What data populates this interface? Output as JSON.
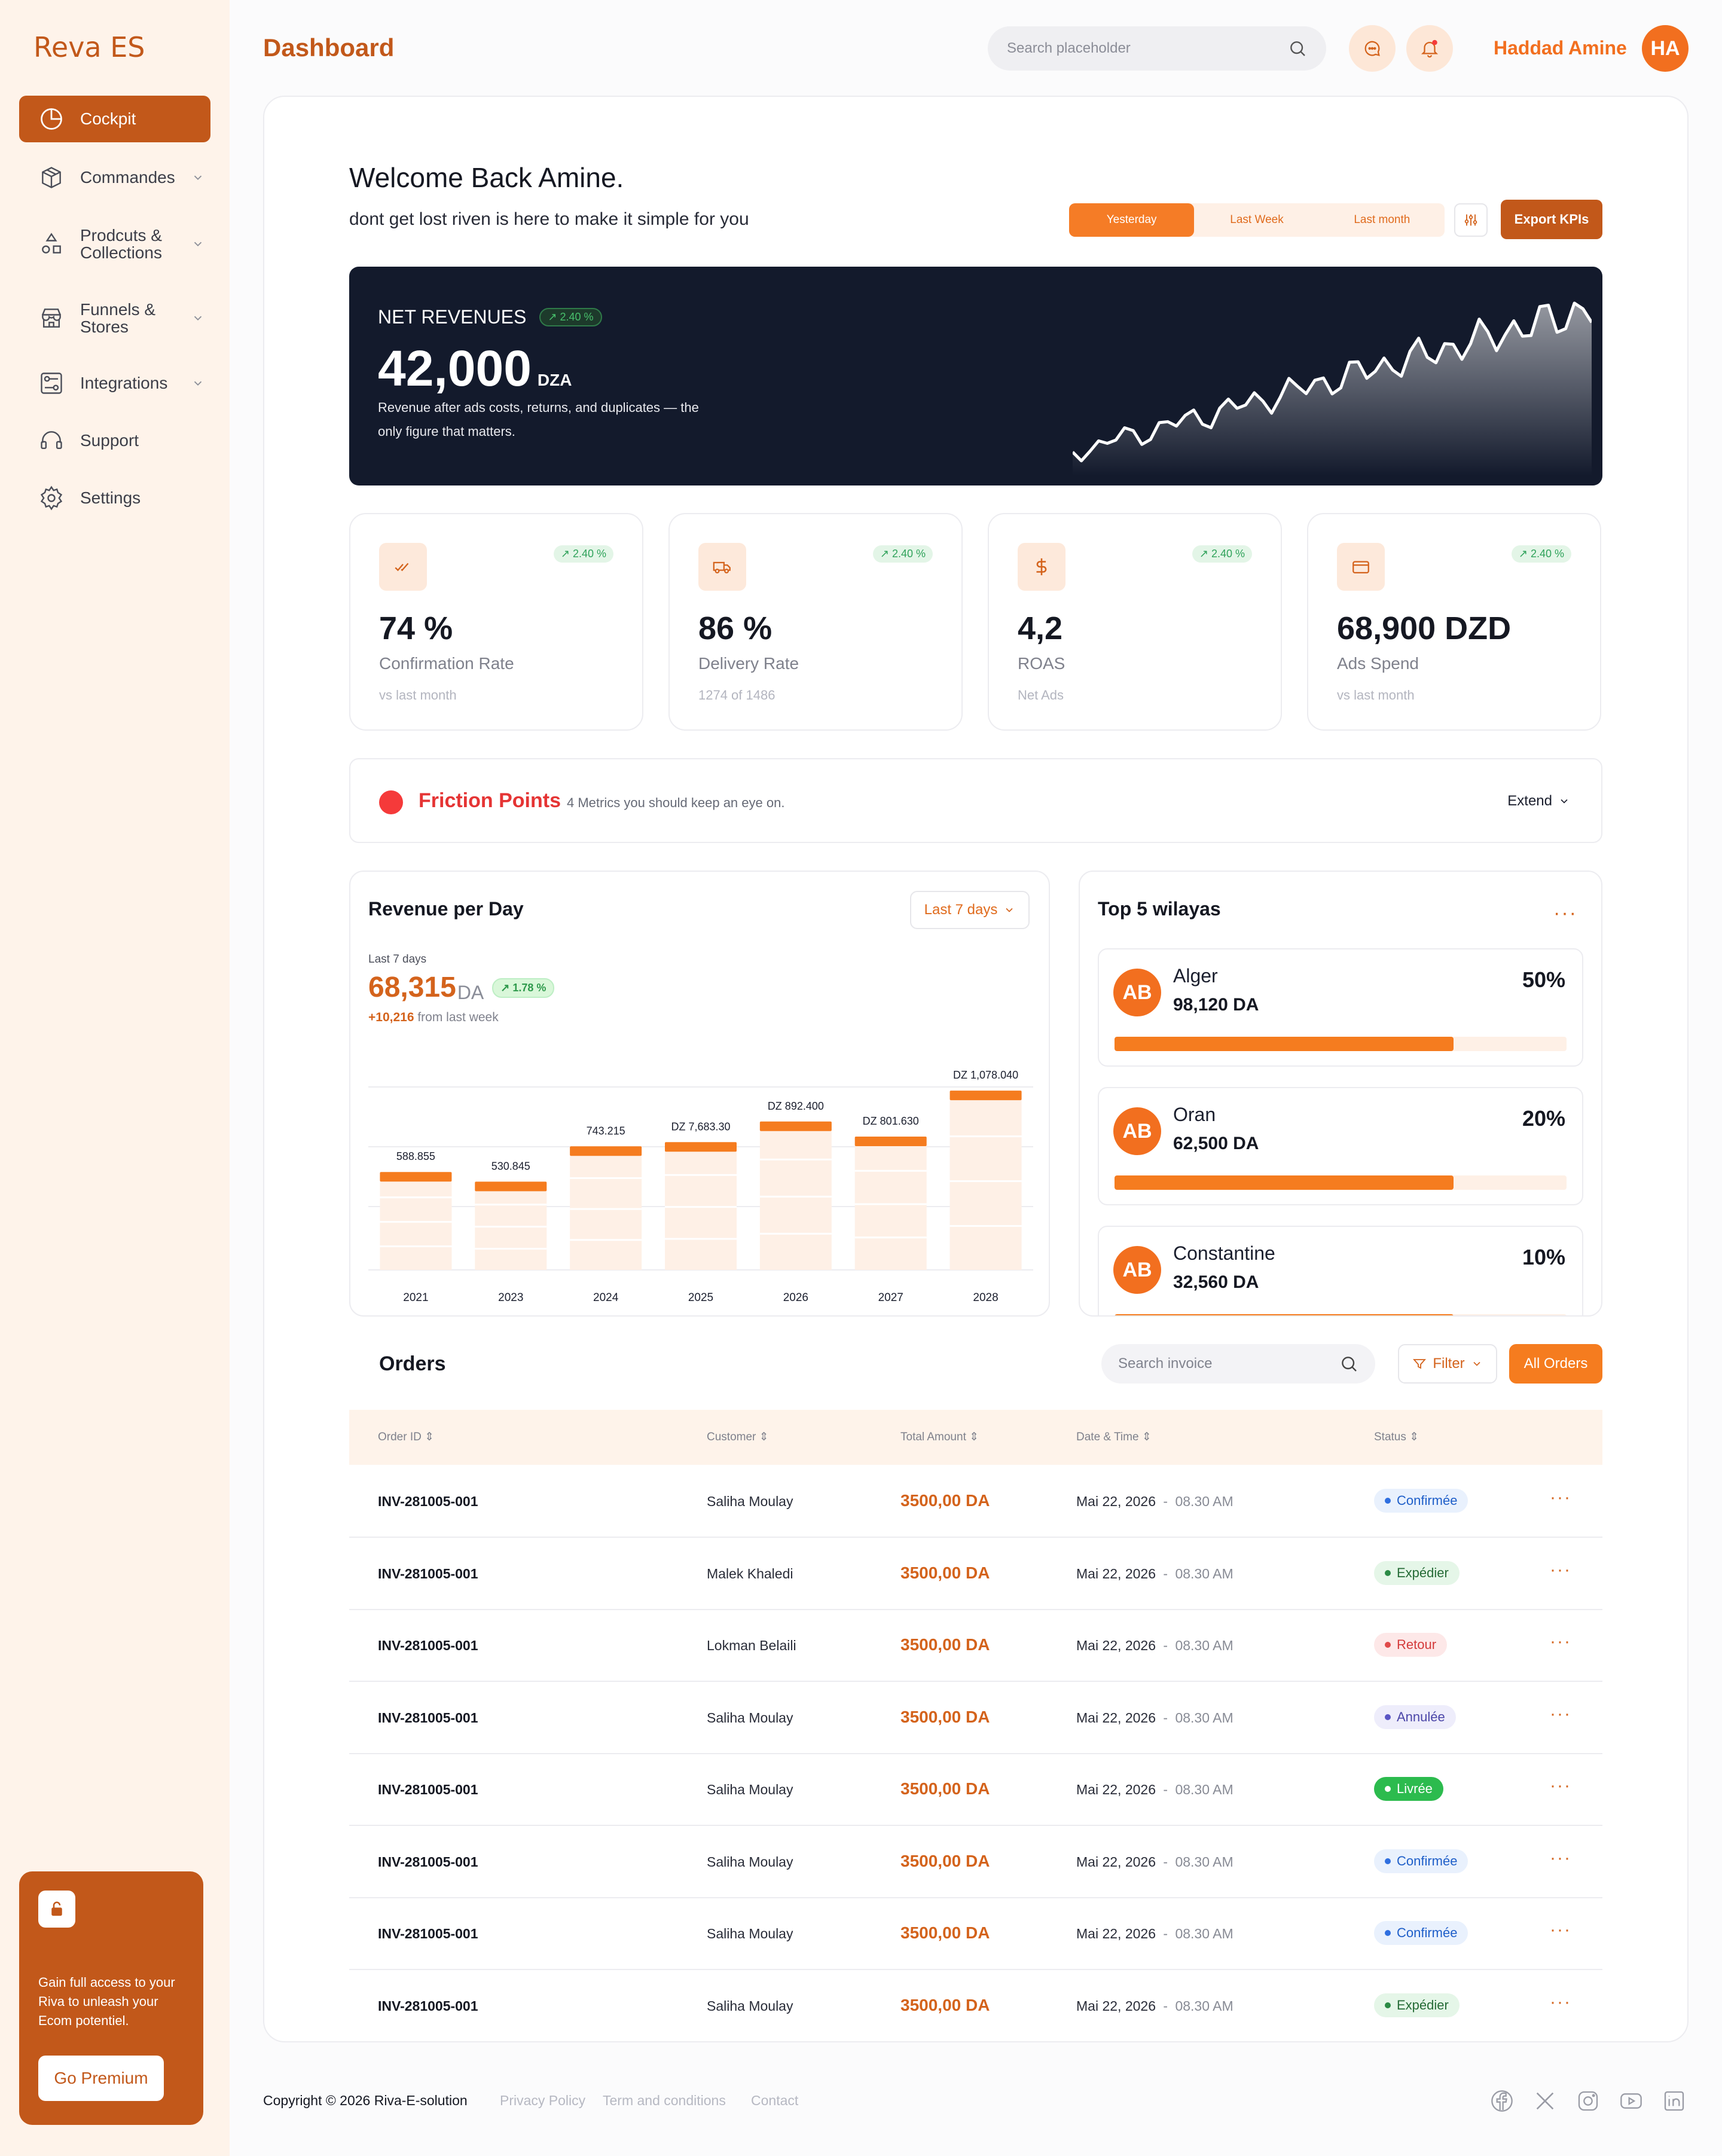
{
  "sidebar": {
    "logo": "Reva ES",
    "items": [
      {
        "label": "Cockpit",
        "icon": "pie-chart-icon",
        "active": true
      },
      {
        "label": "Commandes",
        "icon": "box-icon",
        "chevron": true
      },
      {
        "label": "Prodcuts & Collections",
        "icon": "shapes-icon",
        "chevron": true
      },
      {
        "label": "Funnels & Stores",
        "icon": "store-icon",
        "chevron": true
      },
      {
        "label": "Integrations",
        "icon": "integrations-icon",
        "chevron": true
      },
      {
        "label": "Support",
        "icon": "headset-icon"
      },
      {
        "label": "Settings",
        "icon": "gear-icon"
      }
    ],
    "promo": {
      "text": "Gain full access to your Riva to unleash your Ecom potentiel.",
      "button": "Go Premium"
    }
  },
  "header": {
    "title": "Dashboard",
    "search_placeholder": "Search placeholder",
    "user_name": "Haddad Amine",
    "user_initials": "HA"
  },
  "welcome": {
    "title": "Welcome Back Amine.",
    "subtitle": "dont get lost riven is here to make it simple for you",
    "ranges": [
      "Yesterday",
      "Last Week",
      "Last month"
    ],
    "active_range": "Yesterday",
    "export_label": "Export KPIs"
  },
  "net_revenue": {
    "label": "NET REVENUES",
    "badge": "2.40 %",
    "value": "42,000",
    "unit": "DZA",
    "description": "Revenue after ads costs, returns, and duplicates — the only figure that matters."
  },
  "kpis": [
    {
      "icon": "double-check-icon",
      "badge": "2.40 %",
      "value": "74 %",
      "label": "Confirmation Rate",
      "sub": "vs last month"
    },
    {
      "icon": "truck-icon",
      "badge": "2.40 %",
      "value": "86 %",
      "label": "Delivery Rate",
      "sub": "1274 of 1486"
    },
    {
      "icon": "dollar-icon",
      "badge": "2.40 %",
      "value": "4,2",
      "label": "ROAS",
      "sub": "Net Ads"
    },
    {
      "icon": "card-icon",
      "badge": "2.40 %",
      "value": "68,900 DZD",
      "label": "Ads Spend",
      "sub": "vs last month"
    }
  ],
  "friction": {
    "title": "Friction Points",
    "subtitle": "4 Metrics you should keep an eye on.",
    "action": "Extend"
  },
  "revenue_panel": {
    "title": "Revenue per Day",
    "select": "Last 7 days",
    "period_label": "Last 7 days",
    "value": "68,315",
    "unit": "DA",
    "badge": "1.78 %",
    "delta": "+10,216",
    "delta_text": "from last week"
  },
  "chart_data": {
    "type": "bar",
    "categories": [
      "2021",
      "2023",
      "2024",
      "2025",
      "2026",
      "2027",
      "2028"
    ],
    "values": [
      588855,
      530845,
      743215,
      768330,
      892400,
      801630,
      1078040
    ],
    "data_labels": [
      "588.855",
      "530.845",
      "743.215",
      "DZ 7,683.30",
      "DZ 892.400",
      "DZ 801.630",
      "DZ 1,078.040"
    ],
    "title": "Revenue per Day",
    "xlabel": "",
    "ylabel": "",
    "grid": true,
    "colors": {
      "cap": "#f57c1f",
      "bar": "#fef0e6"
    }
  },
  "wilayas": {
    "title": "Top 5 wilayas",
    "items": [
      {
        "initials": "AB",
        "name": "Alger",
        "amount": "98,120 DA",
        "percent": "50%",
        "progress": 0.75
      },
      {
        "initials": "AB",
        "name": "Oran",
        "amount": "62,500 DA",
        "percent": "20%",
        "progress": 0.75
      },
      {
        "initials": "AB",
        "name": "Constantine",
        "amount": "32,560 DA",
        "percent": "10%",
        "progress": 0.75
      }
    ]
  },
  "orders": {
    "title": "Orders",
    "search_placeholder": "Search invoice",
    "filter_label": "Filter",
    "all_label": "All Orders",
    "columns": [
      "Order ID",
      "Customer",
      "Total Amount",
      "Date & Time",
      "Status"
    ],
    "rows": [
      {
        "id": "INV-281005-001",
        "customer": "Saliha Moulay",
        "amount": "3500,00 DA",
        "date": "Mai 22, 2026",
        "time": "08.30 AM",
        "status": "Confirmée",
        "status_type": "blue"
      },
      {
        "id": "INV-281005-001",
        "customer": "Malek Khaledi",
        "amount": "3500,00 DA",
        "date": "Mai 22, 2026",
        "time": "08.30 AM",
        "status": "Expédier",
        "status_type": "green"
      },
      {
        "id": "INV-281005-001",
        "customer": "Lokman Belaili",
        "amount": "3500,00 DA",
        "date": "Mai 22, 2026",
        "time": "08.30 AM",
        "status": "Retour",
        "status_type": "red"
      },
      {
        "id": "INV-281005-001",
        "customer": "Saliha Moulay",
        "amount": "3500,00 DA",
        "date": "Mai 22, 2026",
        "time": "08.30 AM",
        "status": "Annulée",
        "status_type": "purple"
      },
      {
        "id": "INV-281005-001",
        "customer": "Saliha Moulay",
        "amount": "3500,00 DA",
        "date": "Mai 22, 2026",
        "time": "08.30 AM",
        "status": "Livrée",
        "status_type": "solid-green"
      },
      {
        "id": "INV-281005-001",
        "customer": "Saliha Moulay",
        "amount": "3500,00 DA",
        "date": "Mai 22, 2026",
        "time": "08.30 AM",
        "status": "Confirmée",
        "status_type": "blue"
      },
      {
        "id": "INV-281005-001",
        "customer": "Saliha Moulay",
        "amount": "3500,00 DA",
        "date": "Mai 22, 2026",
        "time": "08.30 AM",
        "status": "Confirmée",
        "status_type": "blue"
      },
      {
        "id": "INV-281005-001",
        "customer": "Saliha Moulay",
        "amount": "3500,00 DA",
        "date": "Mai 22, 2026",
        "time": "08.30 AM",
        "status": "Expédier",
        "status_type": "green"
      }
    ]
  },
  "footer": {
    "copyright": "Copyright © 2026 Riva-E-solution",
    "links": [
      "Privacy Policy",
      "Term and conditions",
      "Contact"
    ],
    "social": [
      "facebook-icon",
      "x-icon",
      "instagram-icon",
      "youtube-icon",
      "linkedin-icon"
    ]
  },
  "colors": {
    "brand": "#c2581a",
    "accent": "#f57c1f",
    "dark": "#131a2c"
  }
}
